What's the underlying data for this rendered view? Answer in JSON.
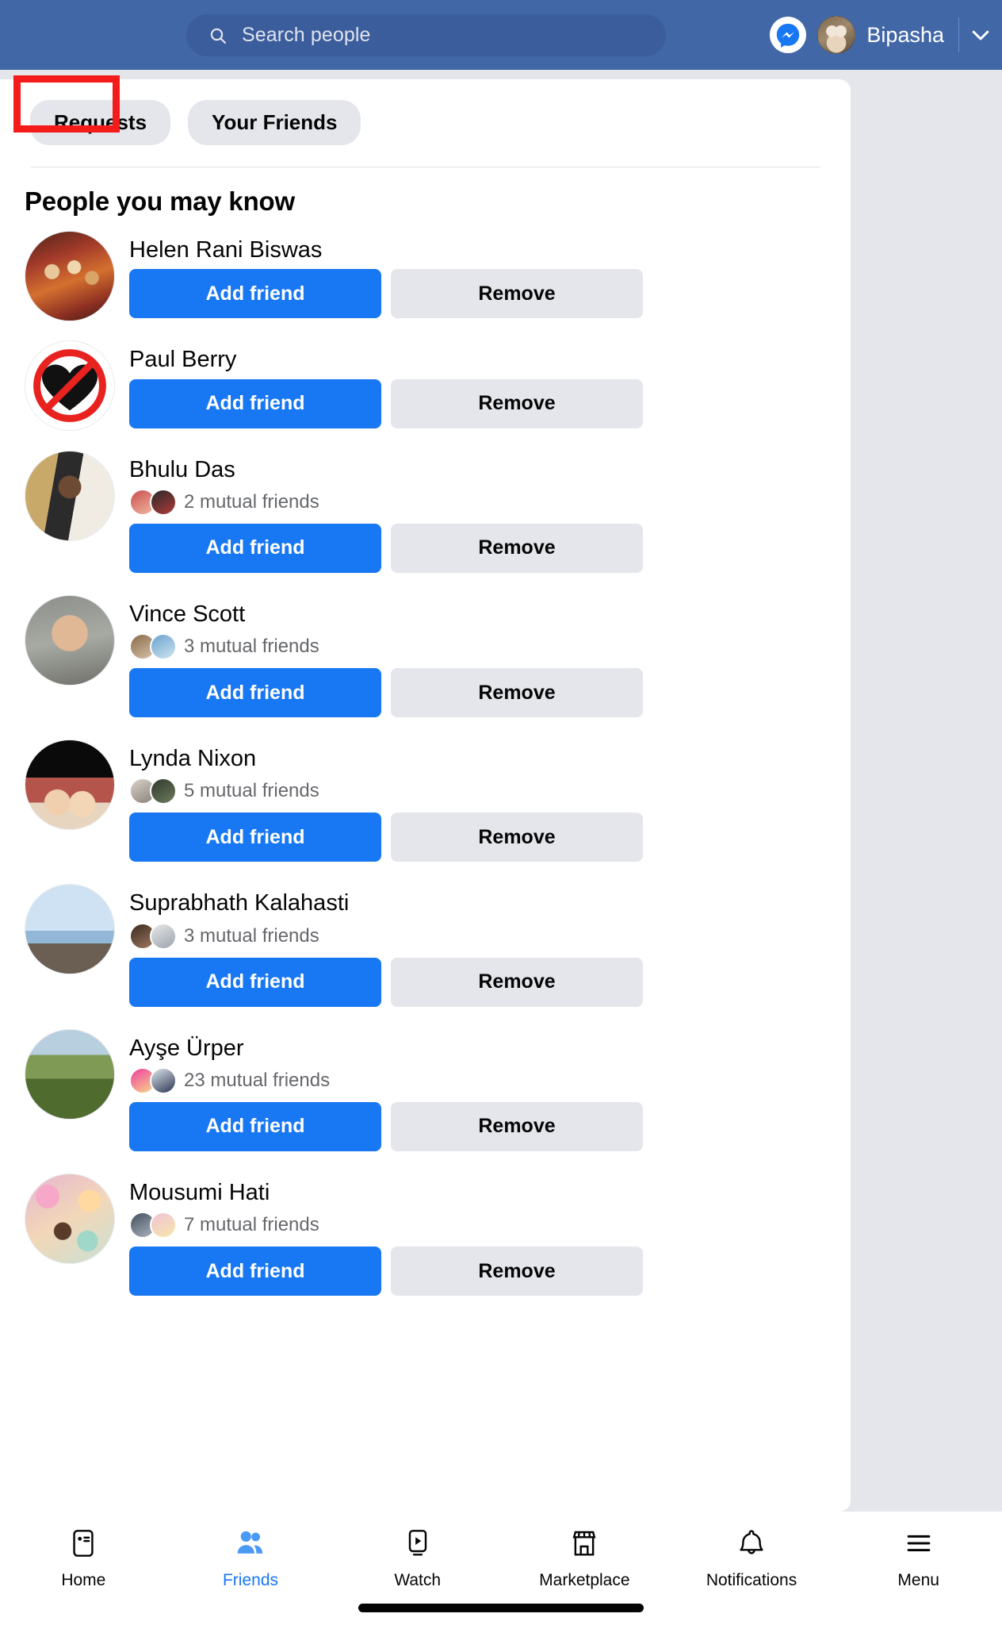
{
  "header": {
    "search_placeholder": "Search people",
    "search_icon": "search-icon",
    "messenger_icon": "messenger-icon",
    "user_name": "Bipasha",
    "chevron_icon": "chevron-down-icon"
  },
  "tabs": [
    {
      "label": "Requests",
      "active": true,
      "highlighted": true
    },
    {
      "label": "Your Friends",
      "active": false,
      "highlighted": false
    }
  ],
  "main": {
    "section_title": "People you may know",
    "add_label": "Add friend",
    "remove_label": "Remove",
    "people": [
      {
        "name": "Helen Rani Biswas",
        "mutual": "",
        "avatar": "av-helen",
        "faces": []
      },
      {
        "name": "Paul Berry",
        "mutual": "",
        "avatar": "av-paul",
        "faces": []
      },
      {
        "name": "Bhulu Das",
        "mutual": "2 mutual friends",
        "avatar": "av-bhulu",
        "faces": [
          "mf-a",
          "mf-b"
        ]
      },
      {
        "name": "Vince Scott",
        "mutual": "3 mutual friends",
        "avatar": "av-vince",
        "faces": [
          "mf-c",
          "mf-d"
        ]
      },
      {
        "name": "Lynda Nixon",
        "mutual": "5 mutual friends",
        "avatar": "av-lynda",
        "faces": [
          "mf-e",
          "mf-f"
        ]
      },
      {
        "name": "Suprabhath Kalahasti",
        "mutual": "3 mutual friends",
        "avatar": "av-supra",
        "faces": [
          "mf-g",
          "mf-h"
        ]
      },
      {
        "name": "Ayşe Ürper",
        "mutual": "23 mutual friends",
        "avatar": "av-ayse",
        "faces": [
          "mf-i",
          "mf-j"
        ]
      },
      {
        "name": "Mousumi Hati",
        "mutual": "7 mutual friends",
        "avatar": "av-mousumi",
        "faces": [
          "mf-k",
          "mf-l"
        ]
      }
    ]
  },
  "bottom_nav": [
    {
      "label": "Home",
      "icon": "home-feed-icon",
      "active": false
    },
    {
      "label": "Friends",
      "icon": "friends-icon",
      "active": true
    },
    {
      "label": "Watch",
      "icon": "watch-play-icon",
      "active": false
    },
    {
      "label": "Marketplace",
      "icon": "marketplace-icon",
      "active": false
    },
    {
      "label": "Notifications",
      "icon": "bell-icon",
      "active": false
    },
    {
      "label": "Menu",
      "icon": "hamburger-menu-icon",
      "active": false
    }
  ],
  "colors": {
    "header_blue": "#4267a7",
    "primary_blue": "#1877f2",
    "neutral_grey": "#e4e6eb",
    "annotation_red": "#f41b1b"
  }
}
